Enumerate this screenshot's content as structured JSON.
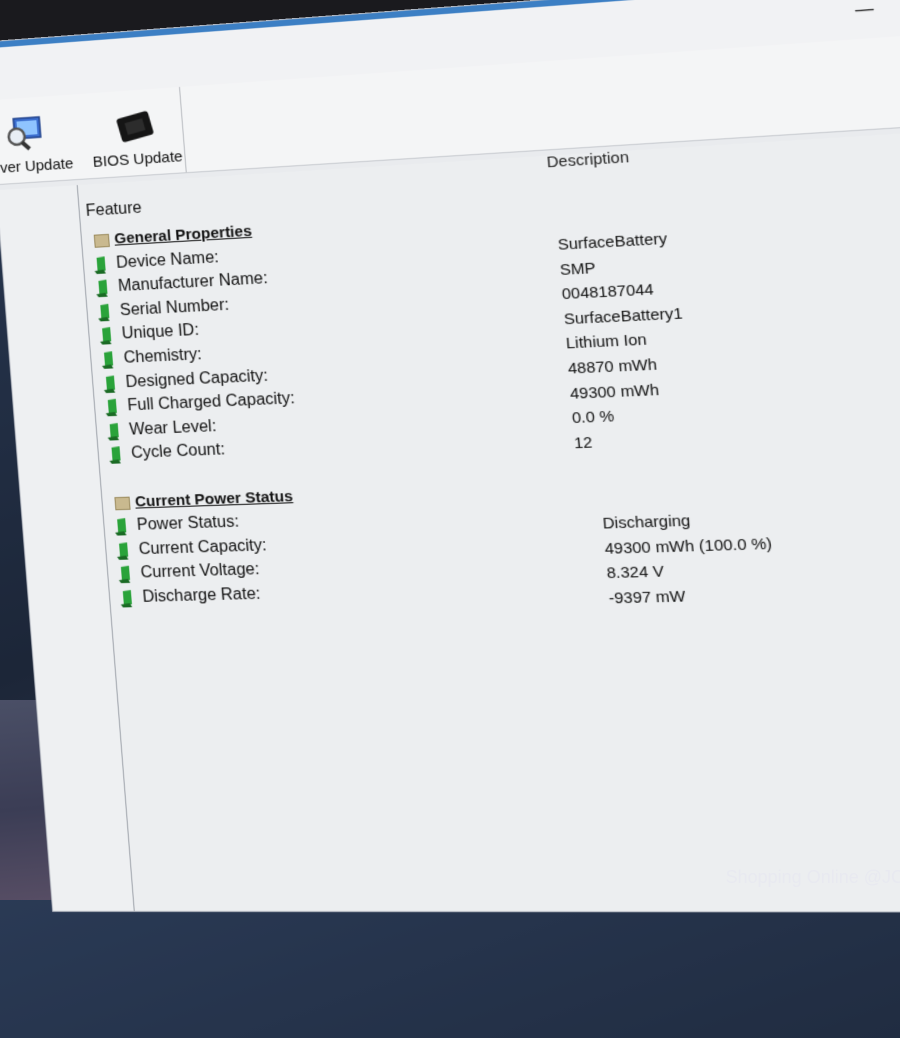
{
  "window": {
    "controls": {
      "minimize": "—",
      "maximize": "",
      "close": "✕"
    }
  },
  "toolbar": {
    "driver_update_label": "Driver Update",
    "bios_update_label": "BIOS Update"
  },
  "table": {
    "header_feature": "Feature",
    "header_description": "Description",
    "general_properties": {
      "title": "General Properties",
      "rows": [
        {
          "label": "Device Name:",
          "value": "SurfaceBattery"
        },
        {
          "label": "Manufacturer Name:",
          "value": "SMP"
        },
        {
          "label": "Serial Number:",
          "value": "0048187044"
        },
        {
          "label": "Unique ID:",
          "value": "SurfaceBattery1"
        },
        {
          "label": "Chemistry:",
          "value": "Lithium Ion"
        },
        {
          "label": "Designed Capacity:",
          "value": "48870 mWh"
        },
        {
          "label": "Full Charged Capacity:",
          "value": "49300 mWh"
        },
        {
          "label": "Wear Level:",
          "value": "0.0 %"
        },
        {
          "label": "Cycle Count:",
          "value": "12"
        }
      ]
    },
    "current_power_status": {
      "title": "Current Power Status",
      "rows": [
        {
          "label": "Power Status:",
          "value": "Discharging"
        },
        {
          "label": "Current Capacity:",
          "value": "49300 mWh (100.0 %)"
        },
        {
          "label": "Current Voltage:",
          "value": "8.324 V"
        },
        {
          "label": "Discharge Rate:",
          "value": "-9397 mW"
        }
      ]
    }
  },
  "watermark": "Shopping Online @JC",
  "icons": {
    "leaf": "green-battery-icon",
    "section": "folder-icon",
    "driver": "driver-search-icon",
    "bios": "bios-chip-icon"
  },
  "colors": {
    "titlebar_accent": "#3c7fc4",
    "leaf_green": "#2aa33a"
  }
}
